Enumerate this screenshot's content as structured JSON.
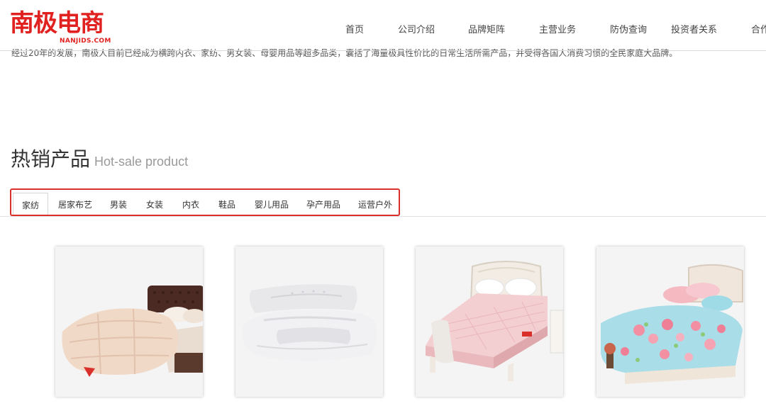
{
  "brand": {
    "logo_text": "南极电商",
    "logo_sub": "NANJIDS.COM",
    "color": "#e0211f"
  },
  "nav": {
    "items": [
      {
        "label": "首页"
      },
      {
        "label": "公司介绍"
      },
      {
        "label": "品牌矩阵"
      },
      {
        "label": "主营业务"
      },
      {
        "label": "防伪查询"
      },
      {
        "label": "投资者关系"
      },
      {
        "label": "合作"
      }
    ]
  },
  "intro": {
    "text": "经过20年的发展，南极人目前已经成为横跨内衣、家纺、男女装、母婴用品等超多品类，囊括了海量极具性价比的日常生活所需产品，并受得各国人消费习惯的全民家庭大品牌。"
  },
  "section": {
    "title_cn": "热销产品",
    "title_en": "Hot-sale product"
  },
  "tabs": {
    "items": [
      {
        "label": "家纺",
        "active": true
      },
      {
        "label": "居家布艺"
      },
      {
        "label": "男装"
      },
      {
        "label": "女装"
      },
      {
        "label": "内衣"
      },
      {
        "label": "鞋品"
      },
      {
        "label": "婴儿用品"
      },
      {
        "label": "孕产用品"
      },
      {
        "label": "运营户外"
      }
    ],
    "highlight_color": "#d9302b"
  },
  "products": {
    "items": [
      {
        "icon": "comforter-image"
      },
      {
        "icon": "pillows-image"
      },
      {
        "icon": "mattress-pad-bed-image"
      },
      {
        "icon": "floral-bedding-set-image"
      }
    ]
  }
}
